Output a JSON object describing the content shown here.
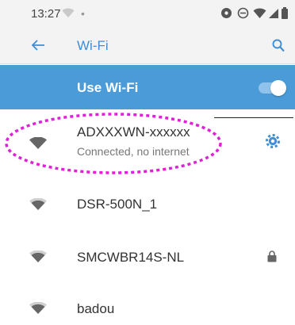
{
  "status_bar": {
    "time": "13:27",
    "dot": "•",
    "icons": [
      "wifi-signal-icon",
      "sync-icon",
      "do-not-disturb-icon",
      "wifi-status-icon",
      "cell-signal-icon",
      "battery-icon"
    ]
  },
  "toolbar": {
    "title": "Wi-Fi",
    "back_icon": "back-arrow-icon",
    "search_icon": "search-icon",
    "accent_color": "#3f8ed6"
  },
  "use_wifi": {
    "label": "Use Wi-Fi",
    "enabled": true,
    "bar_color": "#4a9bd8"
  },
  "networks": [
    {
      "name": "ADXXXWN-xxxxxx",
      "status": "Connected, no internet",
      "action_icon": "gear-icon",
      "highlighted": true
    },
    {
      "name": "DSR-500N_1",
      "status": "",
      "action_icon": ""
    },
    {
      "name": "SMCWBR14S-NL",
      "status": "",
      "action_icon": "lock-icon"
    },
    {
      "name": "badou",
      "status": "",
      "action_icon": ""
    }
  ],
  "highlight_color": "#e020d8"
}
